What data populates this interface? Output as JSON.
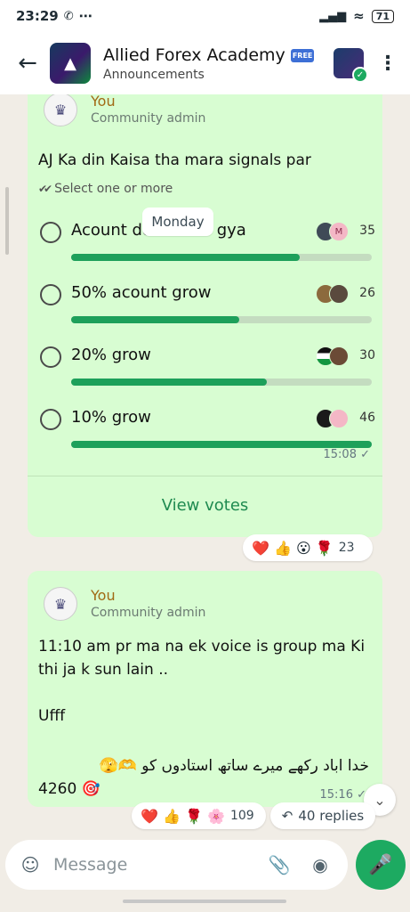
{
  "status_bar": {
    "time": "23:29",
    "more": "⋯",
    "battery": "71"
  },
  "header": {
    "title": "Allied Forex Academy",
    "title_badge": "FREE",
    "subtitle": "Announcements",
    "back_icon": "arrow-left-icon",
    "menu_icon": "more-vert-icon"
  },
  "date_chip": "Monday",
  "poll_message": {
    "sender": "You",
    "role": "Community admin",
    "question": "AJ Ka din Kaisa tha mara signals par",
    "hint": "Select one or more",
    "options": [
      {
        "label": "Acount double ho gya",
        "count": "35",
        "fraction": 0.76,
        "voters": [
          "",
          "M"
        ]
      },
      {
        "label": "50% acount grow",
        "count": "26",
        "fraction": 0.56,
        "voters": [
          "",
          ""
        ]
      },
      {
        "label": "20% grow",
        "count": "30",
        "fraction": 0.65,
        "voters": [
          "",
          ""
        ]
      },
      {
        "label": "10% grow",
        "count": "46",
        "fraction": 1.0,
        "voters": [
          "",
          ""
        ]
      }
    ],
    "time": "15:08 ✓",
    "view_votes": "View votes",
    "reactions": "❤️ 👍 😮 🌹",
    "reaction_count": "23"
  },
  "text_message": {
    "sender": "You",
    "role": "Community admin",
    "line1": "11:10 am pr ma na ek voice is group ma Ki thi ja k sun lain ..",
    "line2": "Ufff",
    "urdu_line": "خدا اباد رکھے میرے ساتھ استادوں کو 🫶🫣",
    "number_line": "4260 🎯",
    "time": "15:16 ✓",
    "reactions": "❤️ 👍 🌹 🌸",
    "reaction_count": "109",
    "replies": "40 replies"
  },
  "composer": {
    "placeholder": "Message"
  },
  "colors": {
    "accent": "#1daa61",
    "bubble": "#d8fdd2",
    "bar_fill": "#1da05a"
  }
}
